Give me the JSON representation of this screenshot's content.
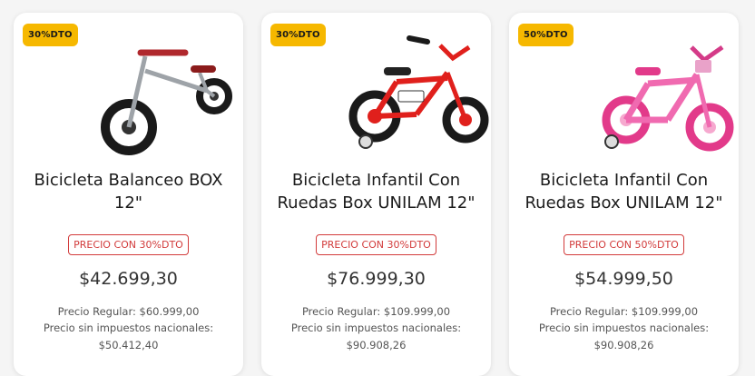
{
  "products": [
    {
      "badge": "30%DTO",
      "title": "Bicicleta Balanceo BOX 12\"",
      "promo": "PRECIO CON 30%DTO",
      "price": "$42.699,30",
      "regular": "Precio Regular: $60.999,00",
      "tax_label": "Precio sin impuestos nacionales:",
      "tax_value": "$50.412,40",
      "frame_color": "#9ea3a8"
    },
    {
      "badge": "30%DTO",
      "title": "Bicicleta Infantil Con Ruedas Box UNILAM 12\"",
      "promo": "PRECIO CON 30%DTO",
      "price": "$76.999,30",
      "regular": "Precio Regular: $109.999,00",
      "tax_label": "Precio sin impuestos nacionales:",
      "tax_value": "$90.908,26",
      "frame_color": "#e0201c"
    },
    {
      "badge": "50%DTO",
      "title": "Bicicleta Infantil Con Ruedas Box UNILAM 12\"",
      "promo": "PRECIO CON 50%DTO",
      "price": "$54.999,50",
      "regular": "Precio Regular: $109.999,00",
      "tax_label": "Precio sin impuestos nacionales:",
      "tax_value": "$90.908,26",
      "frame_color": "#f06ab0"
    }
  ],
  "colors": {
    "badge_bg": "#f6b800",
    "promo_red": "#d23b3b"
  }
}
